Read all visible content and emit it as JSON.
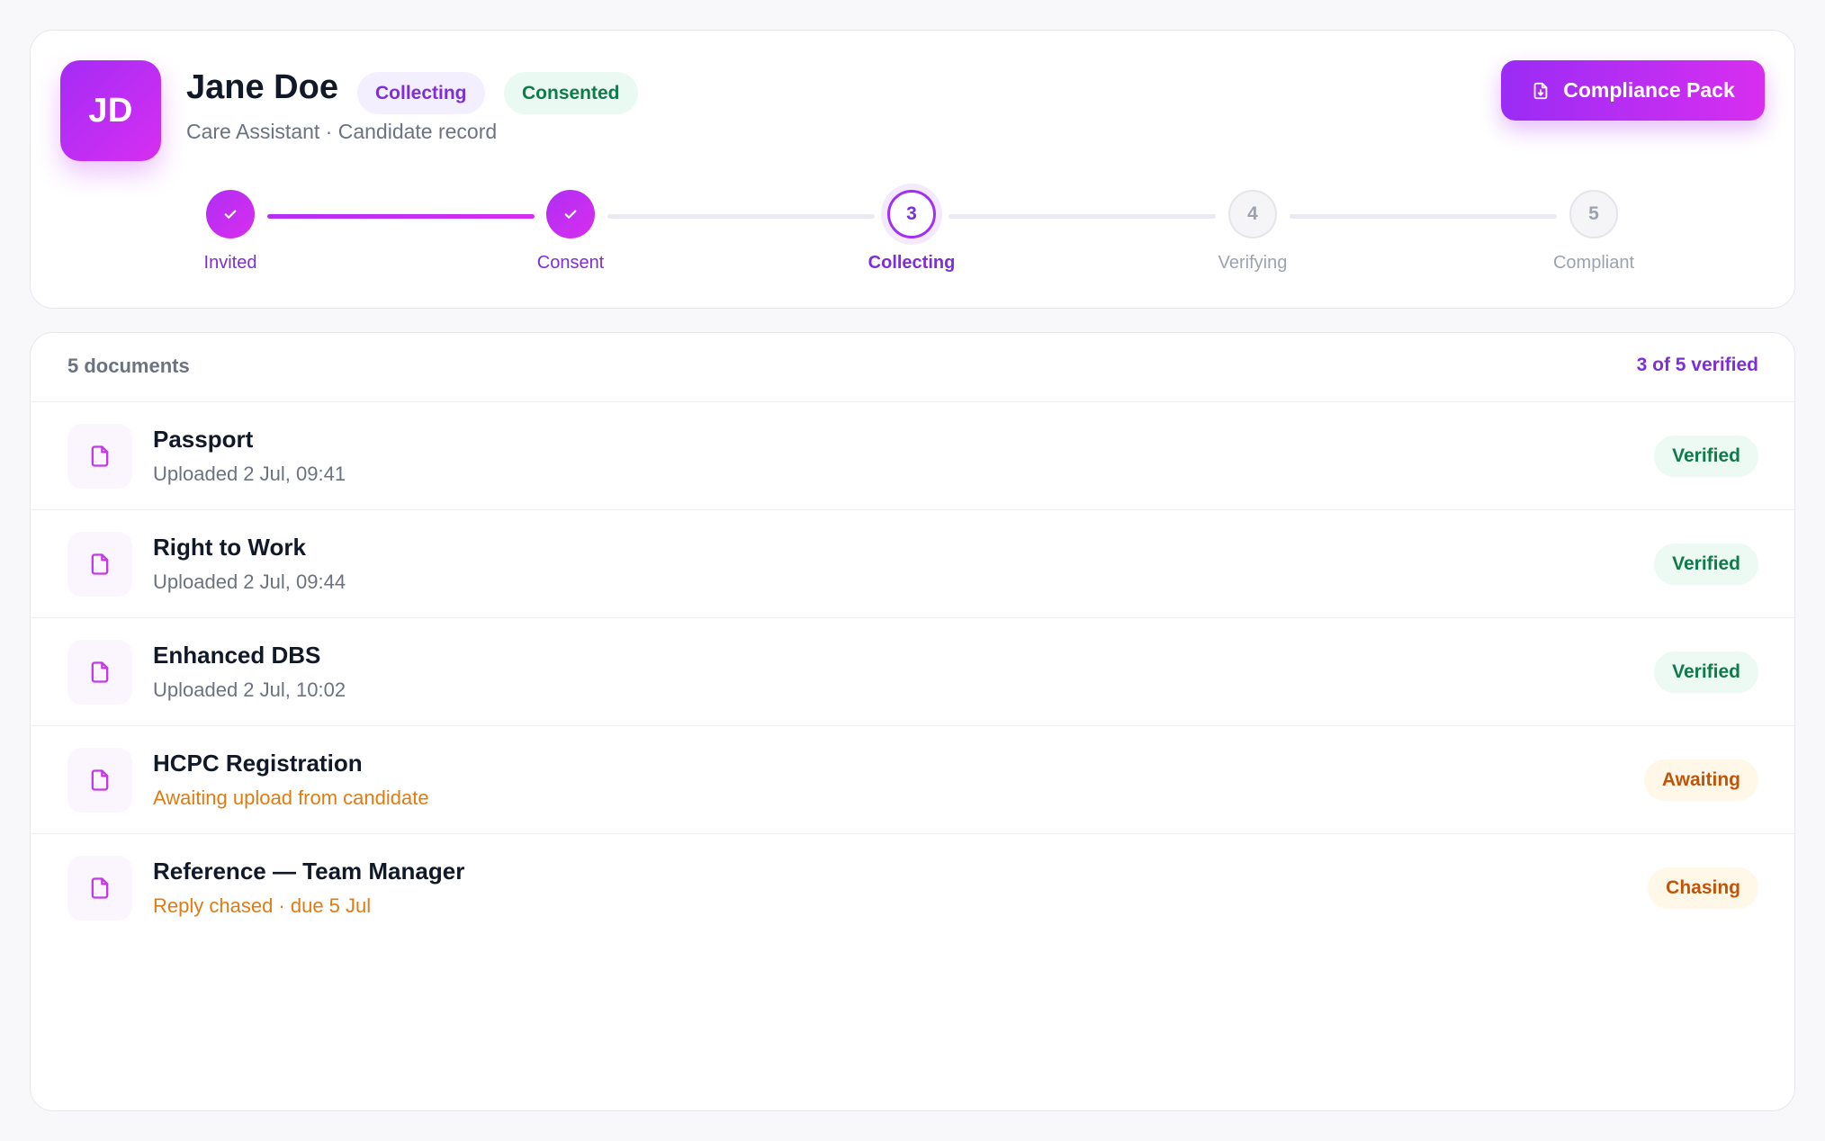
{
  "candidate": {
    "initials": "JD",
    "name": "Jane Doe",
    "status_badge": "Collecting",
    "consent_badge": "Consented",
    "subtitle": "Care Assistant · Candidate record"
  },
  "actions": {
    "compliance_pack_label": "Compliance Pack",
    "compliance_pack_icon": "file-download-icon"
  },
  "stepper": {
    "current_step": 3,
    "steps": [
      {
        "label": "Invited",
        "number": "1",
        "state": "done"
      },
      {
        "label": "Consent",
        "number": "2",
        "state": "done"
      },
      {
        "label": "Collecting",
        "number": "3",
        "state": "active"
      },
      {
        "label": "Verifying",
        "number": "4",
        "state": "pending"
      },
      {
        "label": "Compliant",
        "number": "5",
        "state": "pending"
      }
    ]
  },
  "documents": {
    "count_label": "5 documents",
    "verified_label": "3 of 5 verified",
    "icon": "document-icon",
    "items": [
      {
        "title": "Passport",
        "subtitle": "Uploaded 2 Jul, 09:41",
        "status": "Verified",
        "tone": "verified"
      },
      {
        "title": "Right to Work",
        "subtitle": "Uploaded 2 Jul, 09:44",
        "status": "Verified",
        "tone": "verified"
      },
      {
        "title": "Enhanced DBS",
        "subtitle": "Uploaded 2 Jul, 10:02",
        "status": "Verified",
        "tone": "verified"
      },
      {
        "title": "HCPC Registration",
        "subtitle": "Awaiting upload from candidate",
        "status": "Awaiting",
        "tone": "warn"
      },
      {
        "title": "Reference — Team Manager",
        "subtitle": "Reply chased · due 5 Jul",
        "status": "Chasing",
        "tone": "warn"
      }
    ]
  },
  "colors": {
    "accent": "#a22ff3",
    "accent_pink": "#d82ef0",
    "success": "#0f7a4a",
    "warning": "#e07b12"
  }
}
